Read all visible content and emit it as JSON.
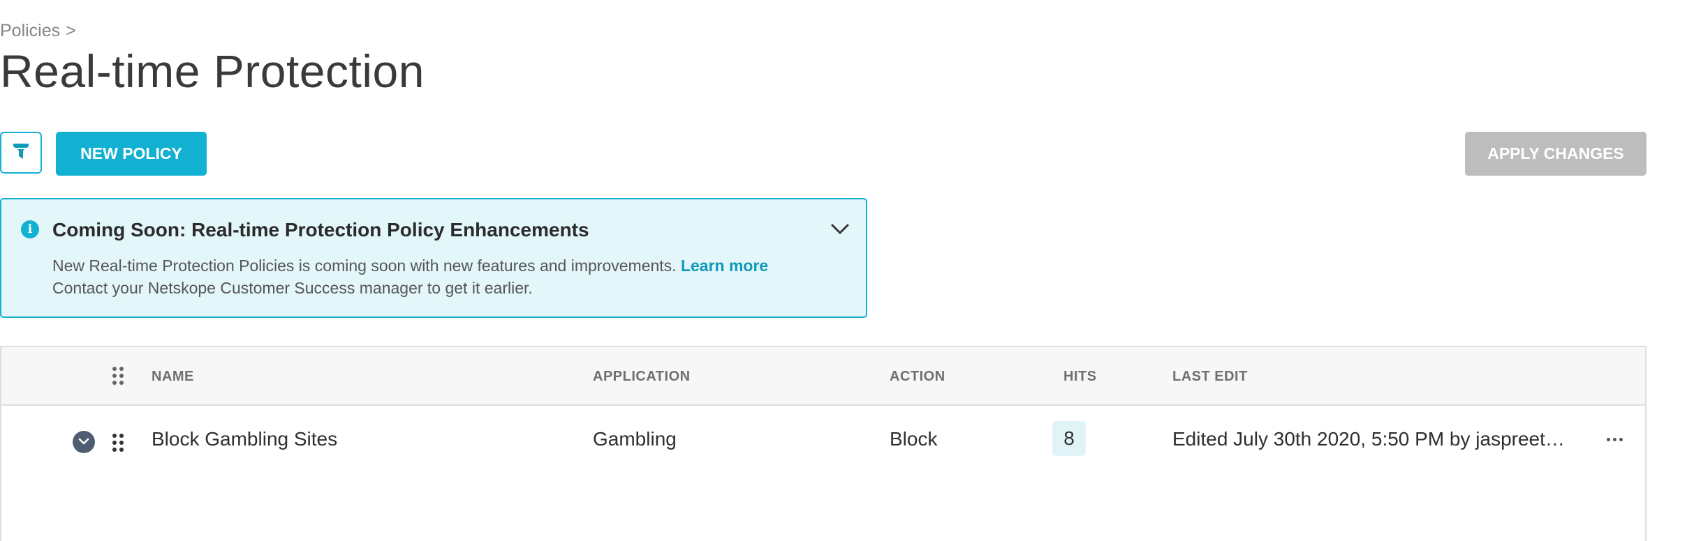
{
  "breadcrumb": {
    "parent": "Policies",
    "separator": ">"
  },
  "page": {
    "title": "Real-time Protection"
  },
  "toolbar": {
    "filter_icon": "filter-icon",
    "new_policy_label": "NEW POLICY",
    "apply_changes_label": "APPLY CHANGES"
  },
  "banner": {
    "icon": "info-icon",
    "title": "Coming Soon: Real-time Protection Policy Enhancements",
    "line1_text": "New Real-time Protection Policies is coming soon with new features and improvements.",
    "learn_more": "Learn more",
    "line2_text": "Contact your Netskope Customer Success manager to get it earlier."
  },
  "table": {
    "columns": {
      "name": "NAME",
      "application": "APPLICATION",
      "action": "ACTION",
      "hits": "HITS",
      "last_edit": "LAST EDIT"
    },
    "rows": [
      {
        "name": "Block Gambling Sites",
        "application": "Gambling",
        "action": "Block",
        "hits": "8",
        "last_edit": "Edited July 30th 2020, 5:50 PM by jaspreet…"
      }
    ]
  },
  "colors": {
    "accent": "#12b1d2",
    "disabled": "#bdbdbd",
    "banner_bg": "#e3f6fa",
    "link": "#0e9ab8"
  }
}
